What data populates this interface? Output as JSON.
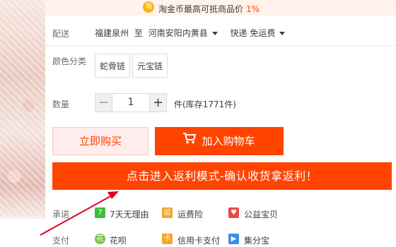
{
  "coin_banner": {
    "icon_char": "淘",
    "text": "淘金币最高可抵商品价",
    "percent": "1%"
  },
  "shipping": {
    "label": "配送",
    "from": "福建泉州",
    "to_word": "至",
    "to": "河南安阳内黄县",
    "method": "快递 免运费"
  },
  "color": {
    "label": "颜色分类",
    "options": [
      "蛇骨链",
      "元宝链"
    ]
  },
  "quantity": {
    "label": "数量",
    "minus": "−",
    "value": "1",
    "plus": "+",
    "stock": "件(库存1771件)"
  },
  "actions": {
    "buy_now": "立即购买",
    "add_cart": "加入购物车"
  },
  "rebate_banner": "点击进入返利模式-确认收货拿返利！",
  "services": {
    "promise_label": "承诺",
    "promise_items": [
      {
        "icon": "7",
        "label": "7天无理由",
        "color": "#3ebb3e"
      },
      {
        "icon": "运",
        "label": "运费险",
        "color": "#f5a623"
      },
      {
        "icon": "♥",
        "label": "公益宝贝",
        "color": "#e84848"
      }
    ],
    "payment_label": "支付",
    "payment_items": [
      {
        "icon": "花",
        "label": "花呗",
        "color": "#7cc243"
      },
      {
        "icon": "卡",
        "label": "信用卡支付",
        "color": "#f5a623"
      },
      {
        "icon": "▶",
        "label": "集分宝",
        "color": "#3c8de8"
      }
    ]
  },
  "colors": {
    "accent": "#ff4400",
    "buy_now_bg": "#ffeded",
    "annotation_arrow": "#e0001b"
  }
}
